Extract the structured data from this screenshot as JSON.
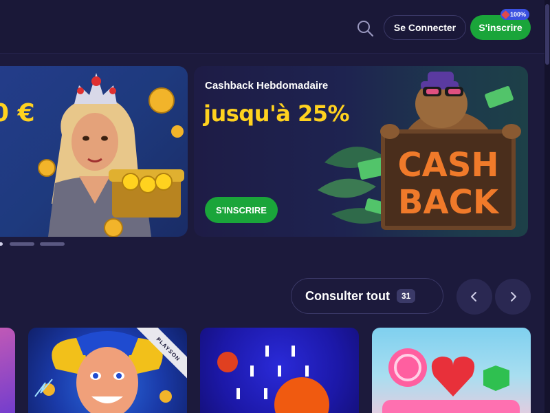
{
  "header": {
    "login_label": "Se Connecter",
    "signup_label": "S'inscrire",
    "badge_text": "100%",
    "search_icon": "search-icon"
  },
  "banners": {
    "left": {
      "amount": "0 €"
    },
    "main": {
      "subtitle": "Cashback Hebdomadaire",
      "title": "jusqu'à 25%",
      "cta_label": "S'INSCRIRE",
      "artwork_text_line1": "CASH",
      "artwork_text_line2": "BACK"
    },
    "carousel_dots": 3,
    "active_dot": 0
  },
  "games_section": {
    "see_all_label": "Consulter tout",
    "see_all_count": "31",
    "prev_icon": "chevron-left-icon",
    "next_icon": "chevron-right-icon",
    "tiles": [
      {
        "id": "partial"
      },
      {
        "provider": "PLAYSON"
      },
      {
        "id": "ball-game"
      },
      {
        "id": "sweets"
      }
    ]
  },
  "colors": {
    "background": "#1c1a3c",
    "accent_green": "#1aa53a",
    "accent_yellow": "#ffd21f",
    "badge_blue": "#3b50e0"
  }
}
